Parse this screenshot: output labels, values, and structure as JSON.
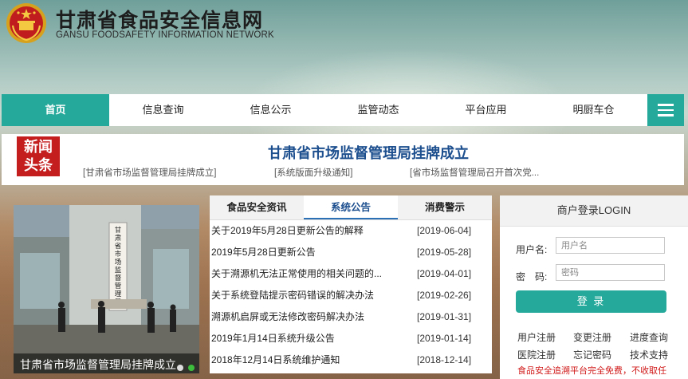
{
  "header": {
    "title": "甘肃省食品安全信息网",
    "subtitle": "GANSU FOODSAFETY INFORMATION NETWORK",
    "logo_icon": "national-emblem-icon"
  },
  "nav": {
    "items": [
      {
        "label": "首页",
        "active": true
      },
      {
        "label": "信息查询",
        "active": false
      },
      {
        "label": "信息公示",
        "active": false
      },
      {
        "label": "监管动态",
        "active": false
      },
      {
        "label": "平台应用",
        "active": false
      },
      {
        "label": "明厨车仓",
        "active": false
      }
    ],
    "menu_icon": "hamburger-menu-icon"
  },
  "headline": {
    "badge": [
      "新闻",
      "头条"
    ],
    "title": "甘肃省市场监督管理局挂牌成立",
    "links": [
      "[甘肃省市场监督管理局挂牌成立]",
      "[系统版面升级通知]",
      "[省市场监督管理局召开首次党..."
    ]
  },
  "slider": {
    "caption": "甘肃省市场监督管理局挂牌成立",
    "sign_text": "甘肃省市场监督管理局",
    "dots": 2,
    "active_dot": 1
  },
  "news": {
    "tabs": [
      {
        "label": "食品安全资讯",
        "active": false
      },
      {
        "label": "系统公告",
        "active": true
      },
      {
        "label": "消费警示",
        "active": false
      }
    ],
    "items": [
      {
        "title": "关于2019年5月28日更新公告的解释",
        "date": "[2019-06-04]"
      },
      {
        "title": "2019年5月28日更新公告",
        "date": "[2019-05-28]"
      },
      {
        "title": "关于溯源机无法正常使用的相关问题的...",
        "date": "[2019-04-01]"
      },
      {
        "title": "关于系统登陆提示密码错误的解决办法",
        "date": "[2019-02-26]"
      },
      {
        "title": "溯源机启屏或无法修改密码解决办法",
        "date": "[2019-01-31]"
      },
      {
        "title": "2019年1月14日系统升级公告",
        "date": "[2019-01-14]"
      },
      {
        "title": "2018年12月14日系统维护通知",
        "date": "[2018-12-14]"
      }
    ]
  },
  "login": {
    "title": "商户登录LOGIN",
    "username_label": "用户名:",
    "username_placeholder": "用户名",
    "password_label": "密　码:",
    "password_placeholder": "密码",
    "button": "登 录",
    "links": [
      "用户注册",
      "变更注册",
      "进度查询",
      "医院注册",
      "忘记密码",
      "技术支持"
    ],
    "notice": "食品安全追溯平台完全免费，不收取任"
  },
  "colors": {
    "accent": "#25a99a",
    "headline_blue": "#1d4f8f",
    "badge_red": "#c41e1e",
    "notice_red": "#d01818"
  }
}
